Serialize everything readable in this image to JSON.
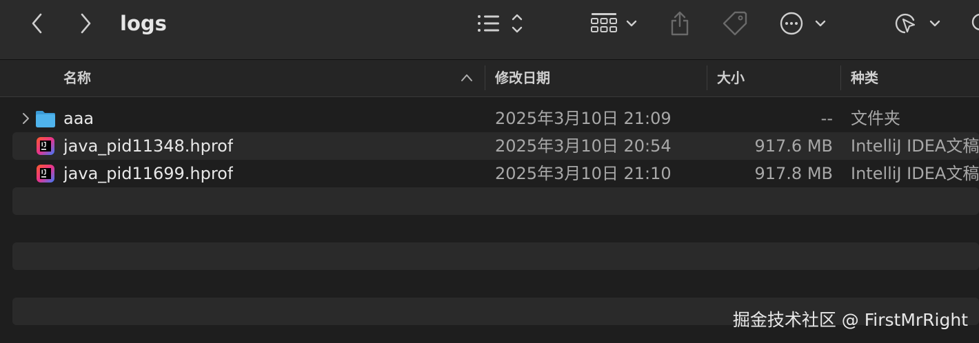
{
  "window": {
    "title": "logs"
  },
  "toolbar": {
    "back_icon": "chevron-left-icon",
    "forward_icon": "chevron-right-icon",
    "view_options_icon": "list-view-icon",
    "group_icon": "grid-view-icon",
    "share_icon": "share-icon",
    "tag_icon": "tag-icon",
    "more_icon": "ellipsis-circle-icon",
    "markup_icon": "pointer-markup-icon"
  },
  "columns": {
    "name": "名称",
    "modified": "修改日期",
    "size": "大小",
    "kind": "种类"
  },
  "files": [
    {
      "name": "aaa",
      "modified": "2025年3月10日 21:09",
      "size": "--",
      "kind": "文件夹",
      "icon": "folder-icon"
    },
    {
      "name": "java_pid11348.hprof",
      "modified": "2025年3月10日 20:54",
      "size": "917.6 MB",
      "kind": "IntelliJ IDEA文稿",
      "icon": "intellij-file-icon"
    },
    {
      "name": "java_pid11699.hprof",
      "modified": "2025年3月10日 21:10",
      "size": "917.8 MB",
      "kind": "IntelliJ IDEA文稿",
      "icon": "intellij-file-icon"
    }
  ],
  "watermark": "掘金技术社区 @ FirstMrRight",
  "colors": {
    "folder": "#4fb3ec",
    "background": "#1e1e1e",
    "toolbar": "#2b2b2b"
  }
}
